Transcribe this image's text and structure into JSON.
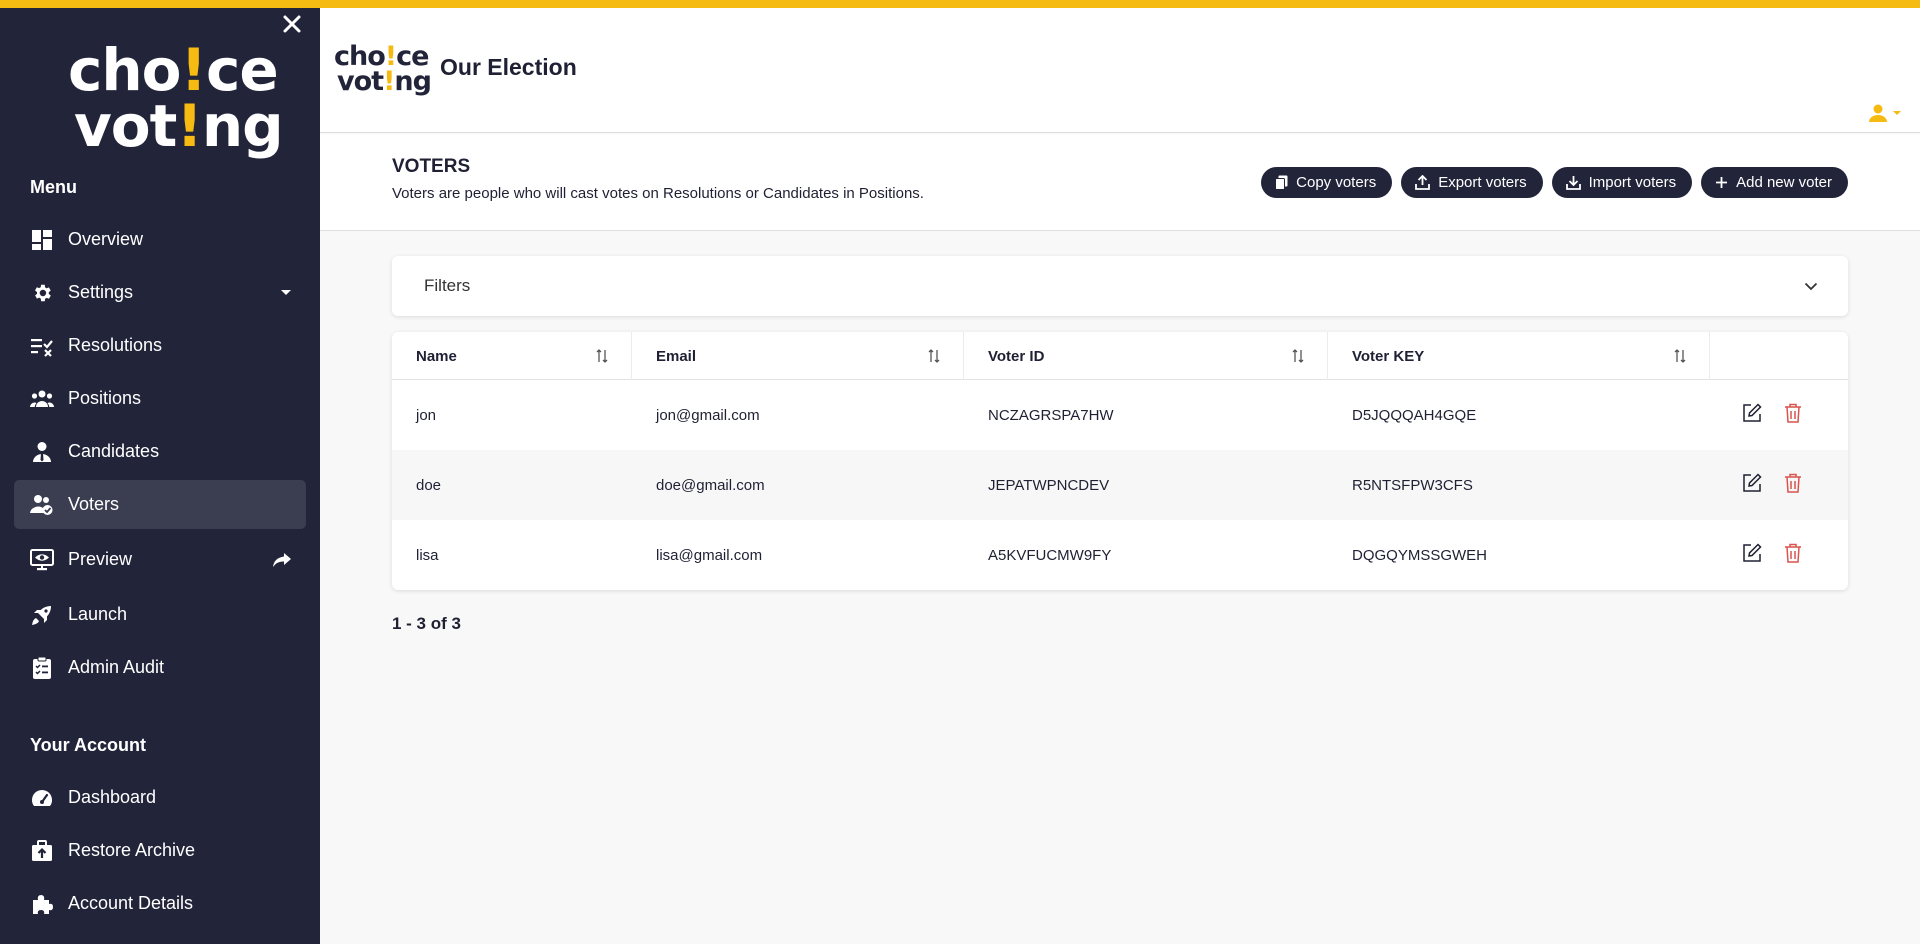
{
  "brand": {
    "line1a": "cho",
    "line1b": "!",
    "line1c": "ce",
    "line2a": "vot",
    "line2b": "!",
    "line2c": "ng",
    "accent_color": "#f6bb12"
  },
  "sidebar": {
    "menu_title": "Menu",
    "items": [
      {
        "label": "Overview",
        "icon": "dashboard-grid-icon"
      },
      {
        "label": "Settings",
        "icon": "gear-icon"
      },
      {
        "label": "Resolutions",
        "icon": "checklist-icon"
      },
      {
        "label": "Positions",
        "icon": "group-icon"
      },
      {
        "label": "Candidates",
        "icon": "candidate-icon"
      },
      {
        "label": "Voters",
        "icon": "voters-icon"
      },
      {
        "label": "Preview",
        "icon": "preview-icon"
      },
      {
        "label": "Launch",
        "icon": "rocket-icon"
      },
      {
        "label": "Admin Audit",
        "icon": "clipboard-icon"
      }
    ],
    "account_title": "Your Account",
    "account_items": [
      {
        "label": "Dashboard",
        "icon": "speedometer-icon"
      },
      {
        "label": "Restore Archive",
        "icon": "archive-upload-icon"
      },
      {
        "label": "Account Details",
        "icon": "puzzle-icon"
      }
    ]
  },
  "header": {
    "title": "Our Election"
  },
  "section": {
    "title": "VOTERS",
    "description": "Voters are people who will cast votes on Resolutions or Candidates in Positions.",
    "buttons": {
      "copy": "Copy voters",
      "export": "Export voters",
      "import": "Import voters",
      "add": "Add new voter"
    }
  },
  "filters": {
    "label": "Filters"
  },
  "table": {
    "columns": {
      "name": "Name",
      "email": "Email",
      "voter_id": "Voter ID",
      "voter_key": "Voter KEY"
    },
    "rows": [
      {
        "name": "jon",
        "email": "jon@gmail.com",
        "voter_id": "NCZAGRSPA7HW",
        "voter_key": "D5JQQQAH4GQE"
      },
      {
        "name": "doe",
        "email": "doe@gmail.com",
        "voter_id": "JEPATWPNCDEV",
        "voter_key": "R5NTSFPW3CFS"
      },
      {
        "name": "lisa",
        "email": "lisa@gmail.com",
        "voter_id": "A5KVFUCMW9FY",
        "voter_key": "DQGQYMSSGWEH"
      }
    ]
  },
  "pagination": {
    "text": "1 - 3 of 3"
  },
  "colors": {
    "sidebar": "#22243a",
    "active_item": "#3b3d50",
    "accent": "#f6bb12",
    "delete": "#d9534f"
  }
}
